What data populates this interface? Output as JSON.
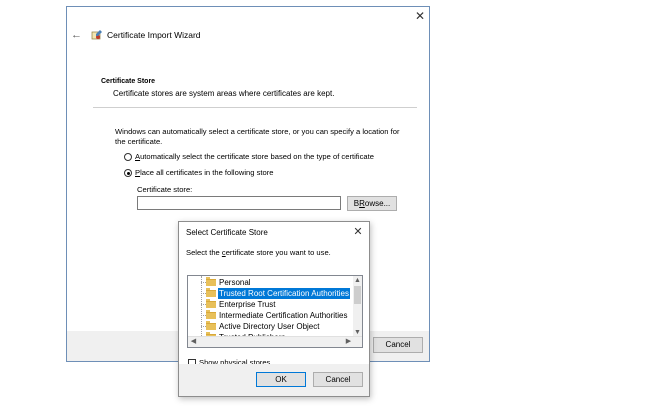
{
  "wizard": {
    "title": "Certificate Import Wizard",
    "section_title": "Certificate Store",
    "section_desc": "Certificate stores are system areas where certificates are kept.",
    "intro_line1": "Windows can automatically select a certificate store, or you can specify a location for",
    "intro_line2": "the certificate.",
    "radio_auto": {
      "prefix": "",
      "accel": "A",
      "rest": "utomatically select the certificate store based on the type of certificate"
    },
    "radio_place": {
      "prefix": "",
      "accel": "P",
      "rest": "lace all certificates in the following store"
    },
    "store_label": "Certificate store:",
    "store_value": "",
    "browse_label": {
      "accel": "R",
      "prefix": "B",
      "rest": "owse..."
    },
    "cancel_label": "Cancel"
  },
  "dialog": {
    "title": "Select Certificate Store",
    "instruction": {
      "prefix": "Select the ",
      "accel": "c",
      "rest": "ertificate store you want to use."
    },
    "stores": [
      "Personal",
      "Trusted Root Certification Authorities",
      "Enterprise Trust",
      "Intermediate Certification Authorities",
      "Active Directory User Object",
      "Trusted Publishers"
    ],
    "selected_index": 1,
    "show_physical": {
      "accel": "S",
      "rest": "how physical stores"
    },
    "ok_label": "OK",
    "cancel_label": "Cancel"
  },
  "icons": {
    "close": "close-icon",
    "back": "back-arrow-icon",
    "wizard": "certificate-wizard-icon"
  }
}
